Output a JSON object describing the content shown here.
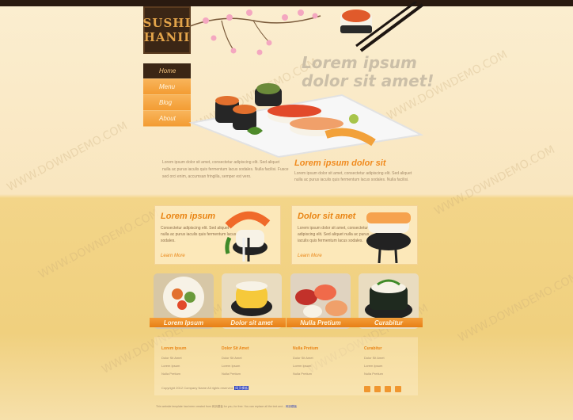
{
  "brand": {
    "line1": "SUSHI",
    "line2": "HANII"
  },
  "nav": [
    {
      "label": "Home",
      "active": true
    },
    {
      "label": "Menu",
      "active": false
    },
    {
      "label": "Blog",
      "active": false
    },
    {
      "label": "About",
      "active": false
    }
  ],
  "hero": {
    "line1": "Lorem ipsum",
    "line2": "dolor sit amet!"
  },
  "intro": {
    "text": "Lorem ipsum dolor sit amet, consectetur adipiscing elit. Sed aliquet nulla ac purus iaculis quis fermentum lacus sodales. Nulla facilisi. Fusce sed orci enim, accumsan fringilla, semper est vero."
  },
  "intro_right": {
    "title": "Lorem ipsum dolor sit",
    "text": "Lorem ipsum dolor sit amet, consectetur adipiscing elit. Sed aliquet nulla ac purus iaculis quis fermentum lacus sodales. Nulla facilisi."
  },
  "features": [
    {
      "title": "Lorem ipsum",
      "text": "Consectetur adipiscing elit. Sed aliquet nulla ac purus iaculis quis fermentum lacus sodales.",
      "more": "Learn More"
    },
    {
      "title": "Dolor sit amet",
      "text": "Lorem ipsum dolor sit amet, consectetur adipiscing elit. Sed aliquet nulla ac purus iaculis quis fermentum lacus sodales.",
      "more": "Learn More"
    }
  ],
  "thumbs": [
    {
      "label": "Lorem Ipsum"
    },
    {
      "label": "Dolor sit amet"
    },
    {
      "label": "Nulla Pretium"
    },
    {
      "label": "Curabitur"
    }
  ],
  "footer": {
    "columns": [
      {
        "title": "Lorem Ipsum",
        "items": [
          "Dolor Sit Amet",
          "Lorem Ipsum",
          "Nulla Pretium"
        ]
      },
      {
        "title": "Dolor Sit Amet",
        "items": [
          "Dolor Sit Amet",
          "Lorem Ipsum",
          "Nulla Pretium"
        ]
      },
      {
        "title": "Nulla Pretium",
        "items": [
          "Dolor Sit Amet",
          "Lorem Ipsum",
          "Nulla Pretium"
        ]
      },
      {
        "title": "Curabitur",
        "items": [
          "Dolor Sit Amet",
          "Lorem Ipsum",
          "Nulla Pretium"
        ]
      }
    ],
    "copyright": "Copyright 2012 Company Name All rights reserved.",
    "copyright_link": "网页模板",
    "notice": "This website template has been created from 网页模板 for you, for free. You can replace all the text and...",
    "notice_link": "网页模板"
  },
  "watermark": "WWW.DOWNDEMO.COM",
  "colors": {
    "accent": "#f39c33",
    "dark": "#3b2615",
    "heading": "#e98414"
  }
}
